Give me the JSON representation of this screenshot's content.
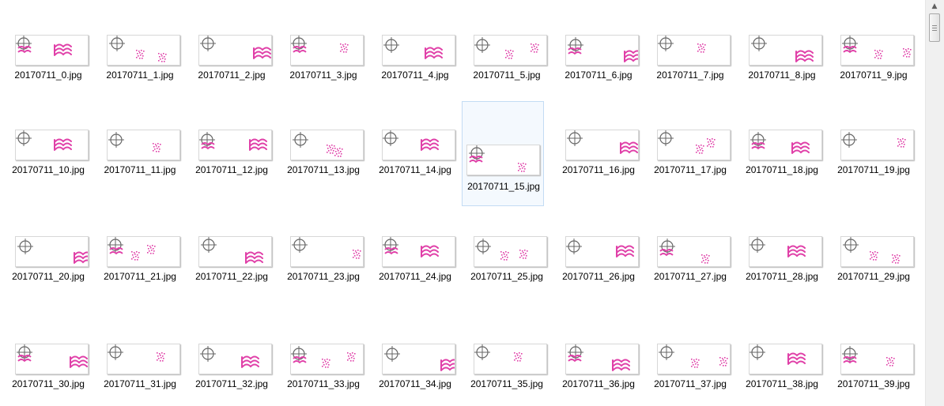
{
  "files": [
    {
      "name": "20170711_0.jpg"
    },
    {
      "name": "20170711_1.jpg"
    },
    {
      "name": "20170711_2.jpg"
    },
    {
      "name": "20170711_3.jpg"
    },
    {
      "name": "20170711_4.jpg"
    },
    {
      "name": "20170711_5.jpg"
    },
    {
      "name": "20170711_6.jpg"
    },
    {
      "name": "20170711_7.jpg"
    },
    {
      "name": "20170711_8.jpg"
    },
    {
      "name": "20170711_9.jpg"
    },
    {
      "name": "20170711_10.jpg"
    },
    {
      "name": "20170711_11.jpg"
    },
    {
      "name": "20170711_12.jpg"
    },
    {
      "name": "20170711_13.jpg"
    },
    {
      "name": "20170711_14.jpg"
    },
    {
      "name": "20170711_15.jpg",
      "selected": true
    },
    {
      "name": "20170711_16.jpg"
    },
    {
      "name": "20170711_17.jpg"
    },
    {
      "name": "20170711_18.jpg"
    },
    {
      "name": "20170711_19.jpg"
    },
    {
      "name": "20170711_20.jpg"
    },
    {
      "name": "20170711_21.jpg"
    },
    {
      "name": "20170711_22.jpg"
    },
    {
      "name": "20170711_23.jpg"
    },
    {
      "name": "20170711_24.jpg"
    },
    {
      "name": "20170711_25.jpg"
    },
    {
      "name": "20170711_26.jpg"
    },
    {
      "name": "20170711_27.jpg"
    },
    {
      "name": "20170711_28.jpg"
    },
    {
      "name": "20170711_29.jpg"
    },
    {
      "name": "20170711_30.jpg"
    },
    {
      "name": "20170711_31.jpg"
    },
    {
      "name": "20170711_32.jpg"
    },
    {
      "name": "20170711_33.jpg"
    },
    {
      "name": "20170711_34.jpg"
    },
    {
      "name": "20170711_35.jpg"
    },
    {
      "name": "20170711_36.jpg"
    },
    {
      "name": "20170711_37.jpg"
    },
    {
      "name": "20170711_38.jpg"
    },
    {
      "name": "20170711_39.jpg"
    }
  ],
  "colors": {
    "selection_bg": "#f4f9fe",
    "selection_border": "#c3dcf4",
    "captcha_pink": "#e040a8",
    "crosshair_gray": "#666666"
  },
  "icons": {
    "scroll_up": "scroll-up-arrow-icon",
    "thumbnail_mark": "crosshair-icon"
  }
}
